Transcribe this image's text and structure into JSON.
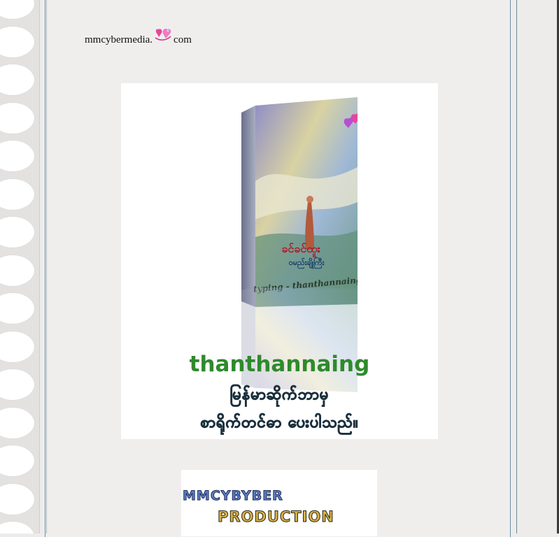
{
  "brand": {
    "prefix": "mmcybermedia.",
    "suffix": "com",
    "logo_icon": "heart-logo-icon"
  },
  "cover": {
    "title": "thanthannaing",
    "line1": "မြန်မာဆိုက်ဘာမှ",
    "line2": "စာရိုက်တင်ဓာ ပေးပါသည်။",
    "book_spine_text": "ခင်ခင်ထူး",
    "book_sub_text": "ဝမည်းချိုကြီး",
    "book_typing": "typing - thanthannaing",
    "badge_icon": "heart-logo-icon"
  },
  "banner": {
    "line1": "MMCYBYBER",
    "line2": "PRODUCTION"
  },
  "colors": {
    "title_green": "#2f8a2c",
    "myanmar_blue": "#3a9fd0",
    "banner_blue": "#5c7fc8",
    "banner_gold": "#d7b24a"
  }
}
